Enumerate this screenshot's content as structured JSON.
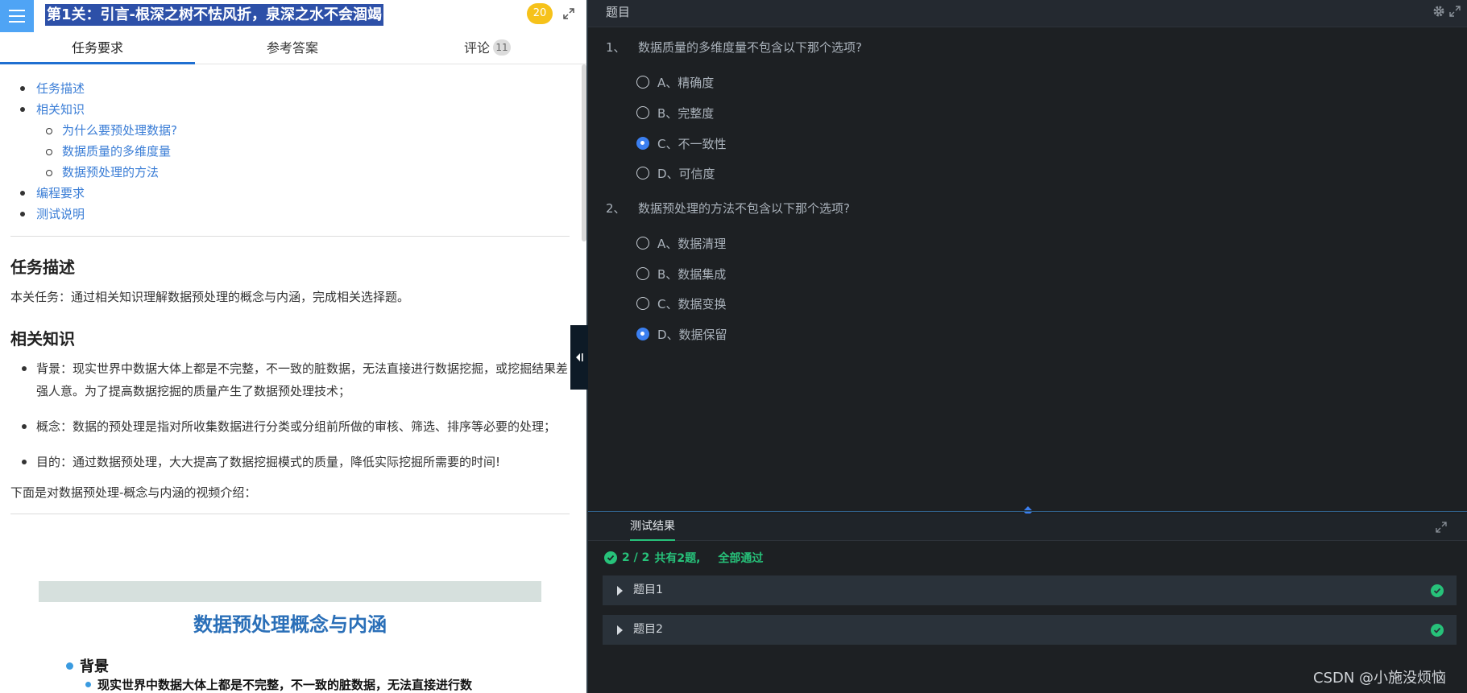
{
  "left": {
    "title": "第1关：引言-根深之树不怯风折，泉深之水不会涸竭",
    "score": "20",
    "tabs": [
      {
        "label": "任务要求"
      },
      {
        "label": "参考答案"
      },
      {
        "label": "评论",
        "count": "11"
      }
    ],
    "toc": {
      "items": [
        "任务描述",
        "相关知识",
        "编程要求",
        "测试说明"
      ],
      "sub_items": [
        "为什么要预处理数据?",
        "数据质量的多维度量",
        "数据预处理的方法"
      ]
    },
    "section1": {
      "heading": "任务描述",
      "text": "本关任务：通过相关知识理解数据预处理的概念与内涵，完成相关选择题。"
    },
    "section2": {
      "heading": "相关知识",
      "bullets": [
        "背景：现实世界中数据大体上都是不完整，不一致的脏数据，无法直接进行数据挖掘，或挖掘结果差强人意。为了提高数据挖掘的质量产生了数据预处理技术；",
        "概念：数据的预处理是指对所收集数据进行分类或分组前所做的审核、筛选、排序等必要的处理；",
        "目的：通过数据预处理，大大提高了数据挖掘模式的质量，降低实际挖掘所需要的时间!"
      ],
      "video_intro": "下面是对数据预处理-概念与内涵的视频介绍："
    },
    "video": {
      "title": "数据预处理概念与内涵",
      "bullet1": "背景",
      "bullet2": "现实世界中数据大体上都是不完整，不一致的脏数据，无法直接进行数"
    }
  },
  "right": {
    "header_title": "题目",
    "questions": [
      {
        "num": "1、",
        "text": "数据质量的多维度量不包含以下那个选项?",
        "options": [
          "A、精确度",
          "B、完整度",
          "C、不一致性",
          "D、可信度"
        ],
        "selected_index": 2
      },
      {
        "num": "2、",
        "text": "数据预处理的方法不包含以下那个选项?",
        "options": [
          "A、数据清理",
          "B、数据集成",
          "C、数据变换",
          "D、数据保留"
        ],
        "selected_index": 3
      }
    ],
    "results": {
      "tab_label": "测试结果",
      "score": "2 / 2",
      "total": "共有2题,",
      "status": "全部通过",
      "rows": [
        {
          "label": "题目1",
          "passed": true
        },
        {
          "label": "题目2",
          "passed": true
        }
      ]
    },
    "watermark": "CSDN @小施没烦恼"
  },
  "colors": {
    "accent_blue": "#3b7ff0",
    "success_green": "#27c27a",
    "title_highlight": "#2d50a8",
    "score_badge": "#f6c21a",
    "dark_bg": "#1d2023"
  }
}
